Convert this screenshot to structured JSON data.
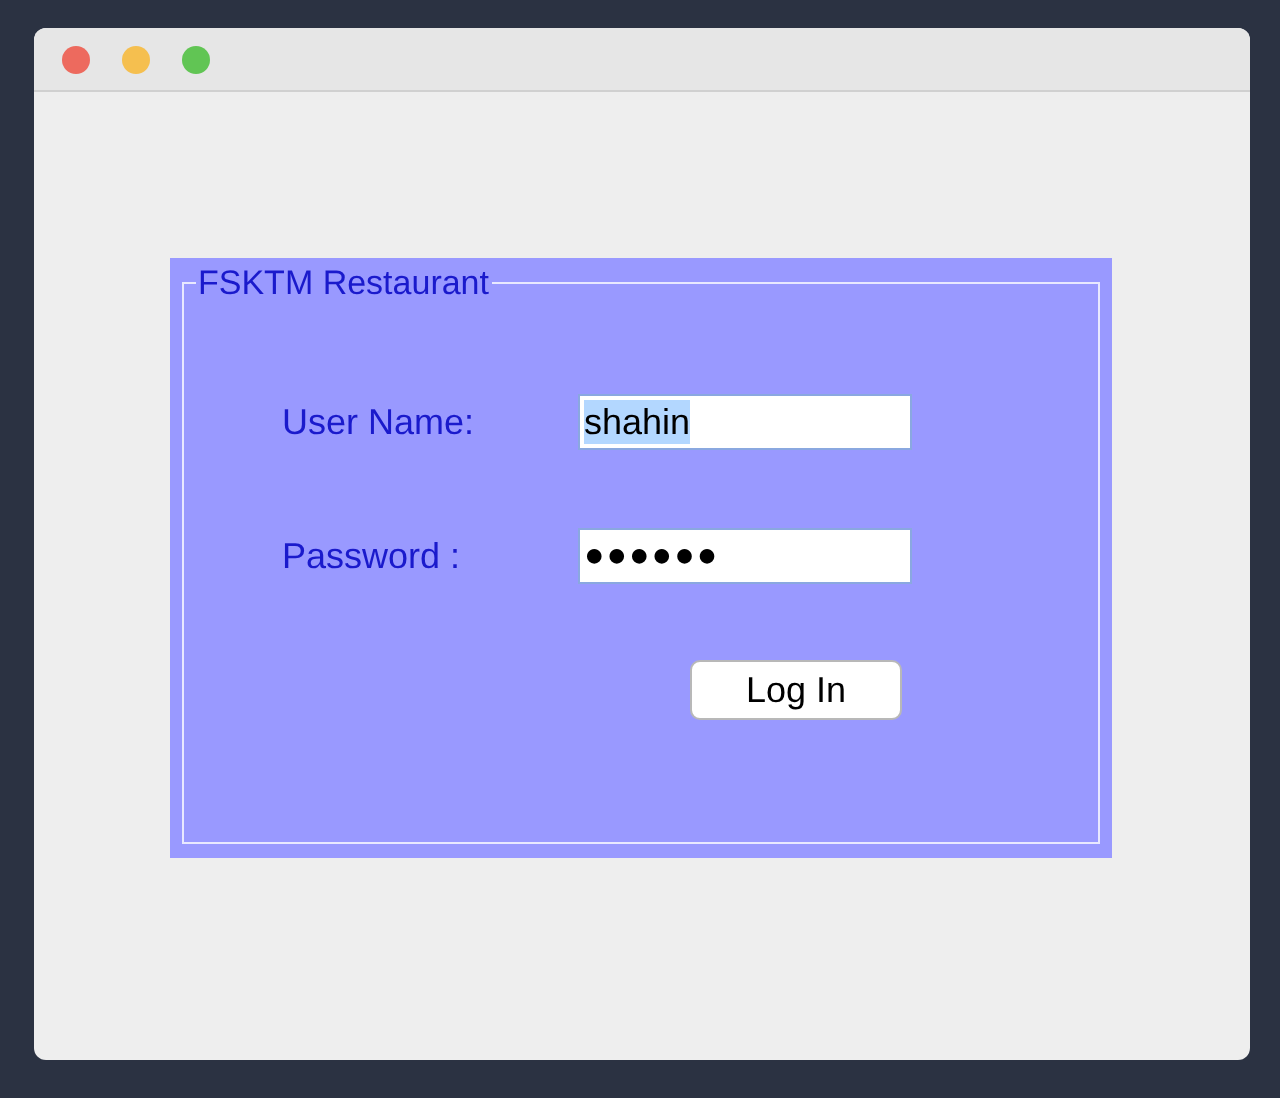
{
  "window": {
    "title_bar": {
      "buttons": [
        {
          "color": "#ed6a5e"
        },
        {
          "color": "#f5bf4f"
        },
        {
          "color": "#61c554"
        }
      ]
    }
  },
  "login_panel": {
    "title": "FSKTM Restaurant",
    "fields": [
      {
        "kind": "text",
        "label": "User Name:",
        "value": "shahin",
        "text_selected": true
      },
      {
        "kind": "password",
        "label": "Password :",
        "value": "●●●●●●",
        "text_selected": false
      }
    ],
    "button": "Log In"
  }
}
